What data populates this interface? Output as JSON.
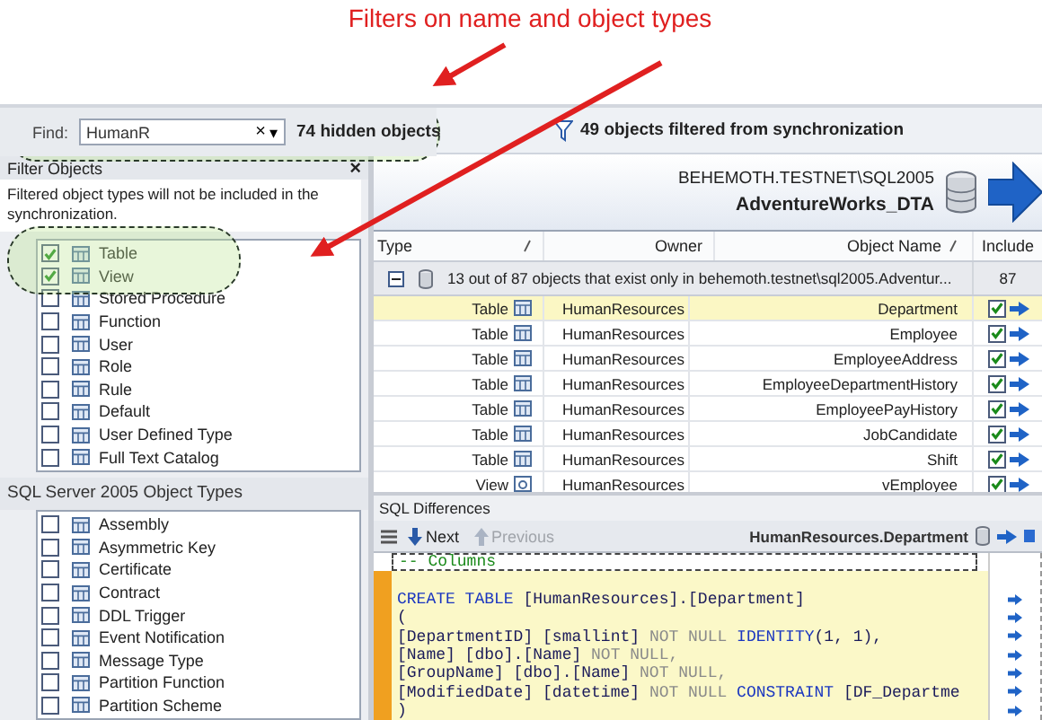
{
  "annotation": {
    "text": "Filters on name and object types"
  },
  "find_bar": {
    "label": "Find:",
    "value": "HumanR",
    "clear": "×",
    "dropdown": "▾",
    "hidden_count": "74 hidden objects"
  },
  "filter_panel": {
    "title": "Filter Objects",
    "close": "×",
    "description": "Filtered object types will not be included in the synchronization.",
    "object_types": [
      {
        "label": "Table",
        "checked": true
      },
      {
        "label": "View",
        "checked": true
      },
      {
        "label": "Stored Procedure",
        "checked": false
      },
      {
        "label": "Function",
        "checked": false
      },
      {
        "label": "User",
        "checked": false
      },
      {
        "label": "Role",
        "checked": false
      },
      {
        "label": "Rule",
        "checked": false
      },
      {
        "label": "Default",
        "checked": false
      },
      {
        "label": "User Defined Type",
        "checked": false
      },
      {
        "label": "Full Text Catalog",
        "checked": false
      }
    ],
    "section_title": "SQL Server 2005 Object Types",
    "sql2005_types": [
      {
        "label": "Assembly",
        "checked": false
      },
      {
        "label": "Asymmetric Key",
        "checked": false
      },
      {
        "label": "Certificate",
        "checked": false
      },
      {
        "label": "Contract",
        "checked": false
      },
      {
        "label": "DDL Trigger",
        "checked": false
      },
      {
        "label": "Event Notification",
        "checked": false
      },
      {
        "label": "Message Type",
        "checked": false
      },
      {
        "label": "Partition Function",
        "checked": false
      },
      {
        "label": "Partition Scheme",
        "checked": false
      }
    ]
  },
  "toolbar": {
    "filter_message": "49 objects filtered from synchronization"
  },
  "source": {
    "server": "BEHEMOTH.TESTNET\\SQL2005",
    "database": "AdventureWorks_DTA"
  },
  "table": {
    "columns": [
      "Type",
      "Owner",
      "Object Name",
      "Include"
    ],
    "group": {
      "text": "13 out of 87 objects that exist only in behemoth.testnet\\sql2005.Adventur...",
      "count": "87",
      "expanded": true
    },
    "rows": [
      {
        "kind": "table",
        "type": "Table",
        "owner": "HumanResources",
        "name": "Department",
        "selected": true,
        "include": true
      },
      {
        "kind": "table",
        "type": "Table",
        "owner": "HumanResources",
        "name": "Employee",
        "selected": false,
        "include": true
      },
      {
        "kind": "table",
        "type": "Table",
        "owner": "HumanResources",
        "name": "EmployeeAddress",
        "selected": false,
        "include": true
      },
      {
        "kind": "table",
        "type": "Table",
        "owner": "HumanResources",
        "name": "EmployeeDepartmentHistory",
        "selected": false,
        "include": true
      },
      {
        "kind": "table",
        "type": "Table",
        "owner": "HumanResources",
        "name": "EmployeePayHistory",
        "selected": false,
        "include": true
      },
      {
        "kind": "table",
        "type": "Table",
        "owner": "HumanResources",
        "name": "JobCandidate",
        "selected": false,
        "include": true
      },
      {
        "kind": "table",
        "type": "Table",
        "owner": "HumanResources",
        "name": "Shift",
        "selected": false,
        "include": true
      },
      {
        "kind": "view",
        "type": "View",
        "owner": "HumanResources",
        "name": "vEmployee",
        "selected": false,
        "include": true
      }
    ]
  },
  "sql_differences": {
    "title": "SQL Differences",
    "next": "Next",
    "previous": "Previous",
    "previous_disabled": true,
    "object": "HumanResources.Department",
    "lines": [
      {
        "kind": "comment",
        "tokens": [
          {
            "kind": "comment",
            "text": "-- Columns"
          }
        ]
      },
      {
        "kind": "blank"
      },
      {
        "kind": "changed",
        "tokens": [
          {
            "kind": "keyword",
            "text": "CREATE TABLE "
          },
          {
            "kind": "text",
            "text": "[HumanResources].[Department]"
          }
        ]
      },
      {
        "kind": "changed",
        "tokens": [
          {
            "kind": "text",
            "text": "("
          }
        ]
      },
      {
        "kind": "changed",
        "tokens": [
          {
            "kind": "text",
            "text": "[DepartmentID] [smallint] "
          },
          {
            "kind": "muted",
            "text": "NOT NULL "
          },
          {
            "kind": "keyword",
            "text": "IDENTITY"
          },
          {
            "kind": "text",
            "text": "(1, 1),"
          }
        ]
      },
      {
        "kind": "changed",
        "tokens": [
          {
            "kind": "text",
            "text": "[Name] [dbo].[Name] "
          },
          {
            "kind": "muted",
            "text": "NOT NULL,"
          }
        ]
      },
      {
        "kind": "changed",
        "tokens": [
          {
            "kind": "text",
            "text": "[GroupName] [dbo].[Name] "
          },
          {
            "kind": "muted",
            "text": "NOT NULL,"
          }
        ]
      },
      {
        "kind": "changed",
        "tokens": [
          {
            "kind": "text",
            "text": "[ModifiedDate] [datetime] "
          },
          {
            "kind": "muted",
            "text": "NOT NULL "
          },
          {
            "kind": "keyword",
            "text": "CONSTRAINT "
          },
          {
            "kind": "text",
            "text": "[DF_Departme"
          }
        ]
      },
      {
        "kind": "changed",
        "tokens": [
          {
            "kind": "text",
            "text": ")"
          }
        ]
      }
    ]
  }
}
